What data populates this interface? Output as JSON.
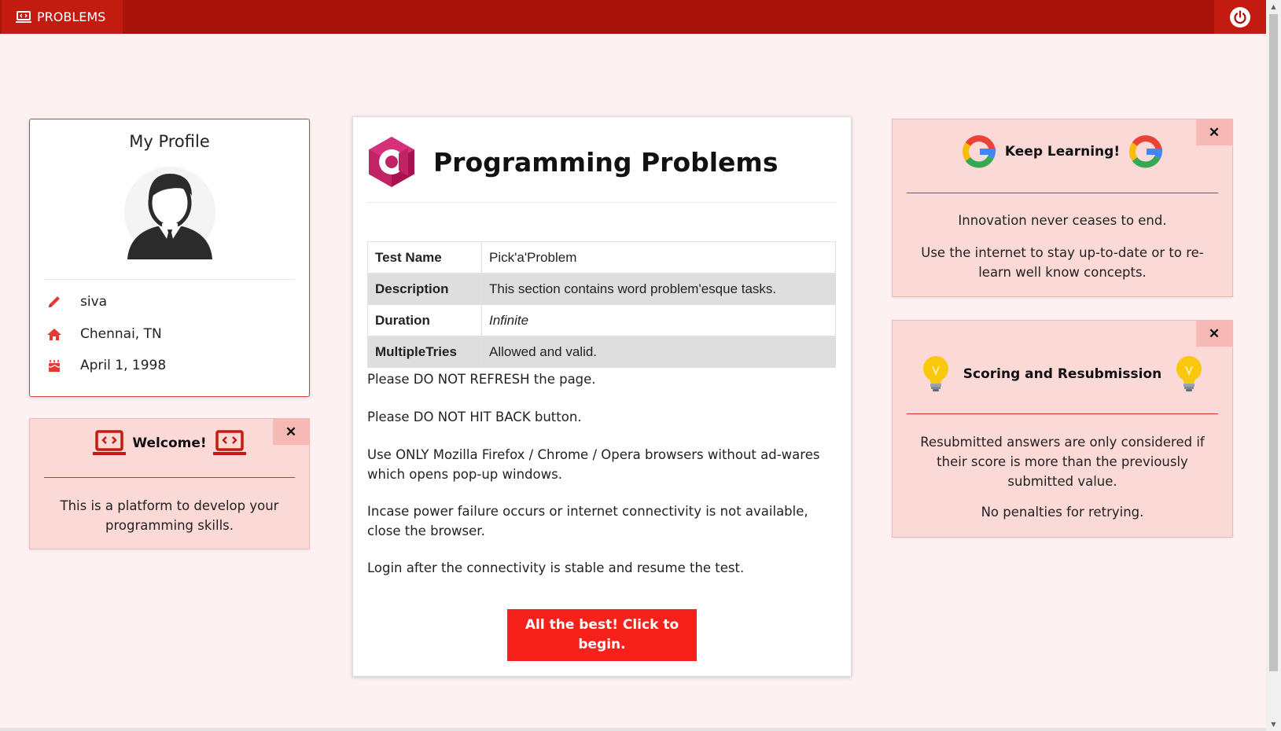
{
  "navbar": {
    "brand_label": "PROBLEMS",
    "brand_icon": "laptop-code-icon",
    "power_icon": "power-icon"
  },
  "profile": {
    "title": "My Profile",
    "name": "siva",
    "location": "Chennai, TN",
    "birthday": "April 1, 1998"
  },
  "welcome": {
    "title": "Welcome!",
    "text": "This is a platform to develop your programming skills.",
    "close": "✕"
  },
  "main": {
    "title": "Programming Problems",
    "table": [
      {
        "key": "Test Name",
        "value": "Pick'a'Problem"
      },
      {
        "key": "Description",
        "value": "This section contains word problem'esque tasks."
      },
      {
        "key": "Duration",
        "value": "Infinite"
      },
      {
        "key": "MultipleTries",
        "value": "Allowed and valid."
      }
    ],
    "notes": [
      "Please DO NOT REFRESH the page.",
      "Please DO NOT HIT BACK button.",
      "Use ONLY Mozilla Firefox / Chrome / Opera browsers without ad-wares which opens pop-up windows.",
      "Incase power failure occurs or internet connectivity is not available, close the browser.",
      "Login after the connectivity is stable and resume the test."
    ],
    "begin_label": "All the best! Click to begin."
  },
  "keep_learning": {
    "title": "Keep Learning!",
    "text1": "Innovation never ceases to end.",
    "text2": "Use the internet to stay up-to-date or to re-learn well know concepts.",
    "close": "✕"
  },
  "scoring": {
    "title": "Scoring and Resubmission",
    "text1": "Resubmitted answers are only considered if their score is more than the previously submitted value.",
    "text2": "No penalties for retrying.",
    "close": "✕"
  },
  "colors": {
    "navbar": "#a8140a",
    "accent": "#f5211a",
    "card_bg": "#fbd9d7",
    "page_bg": "#fdf1f1"
  }
}
